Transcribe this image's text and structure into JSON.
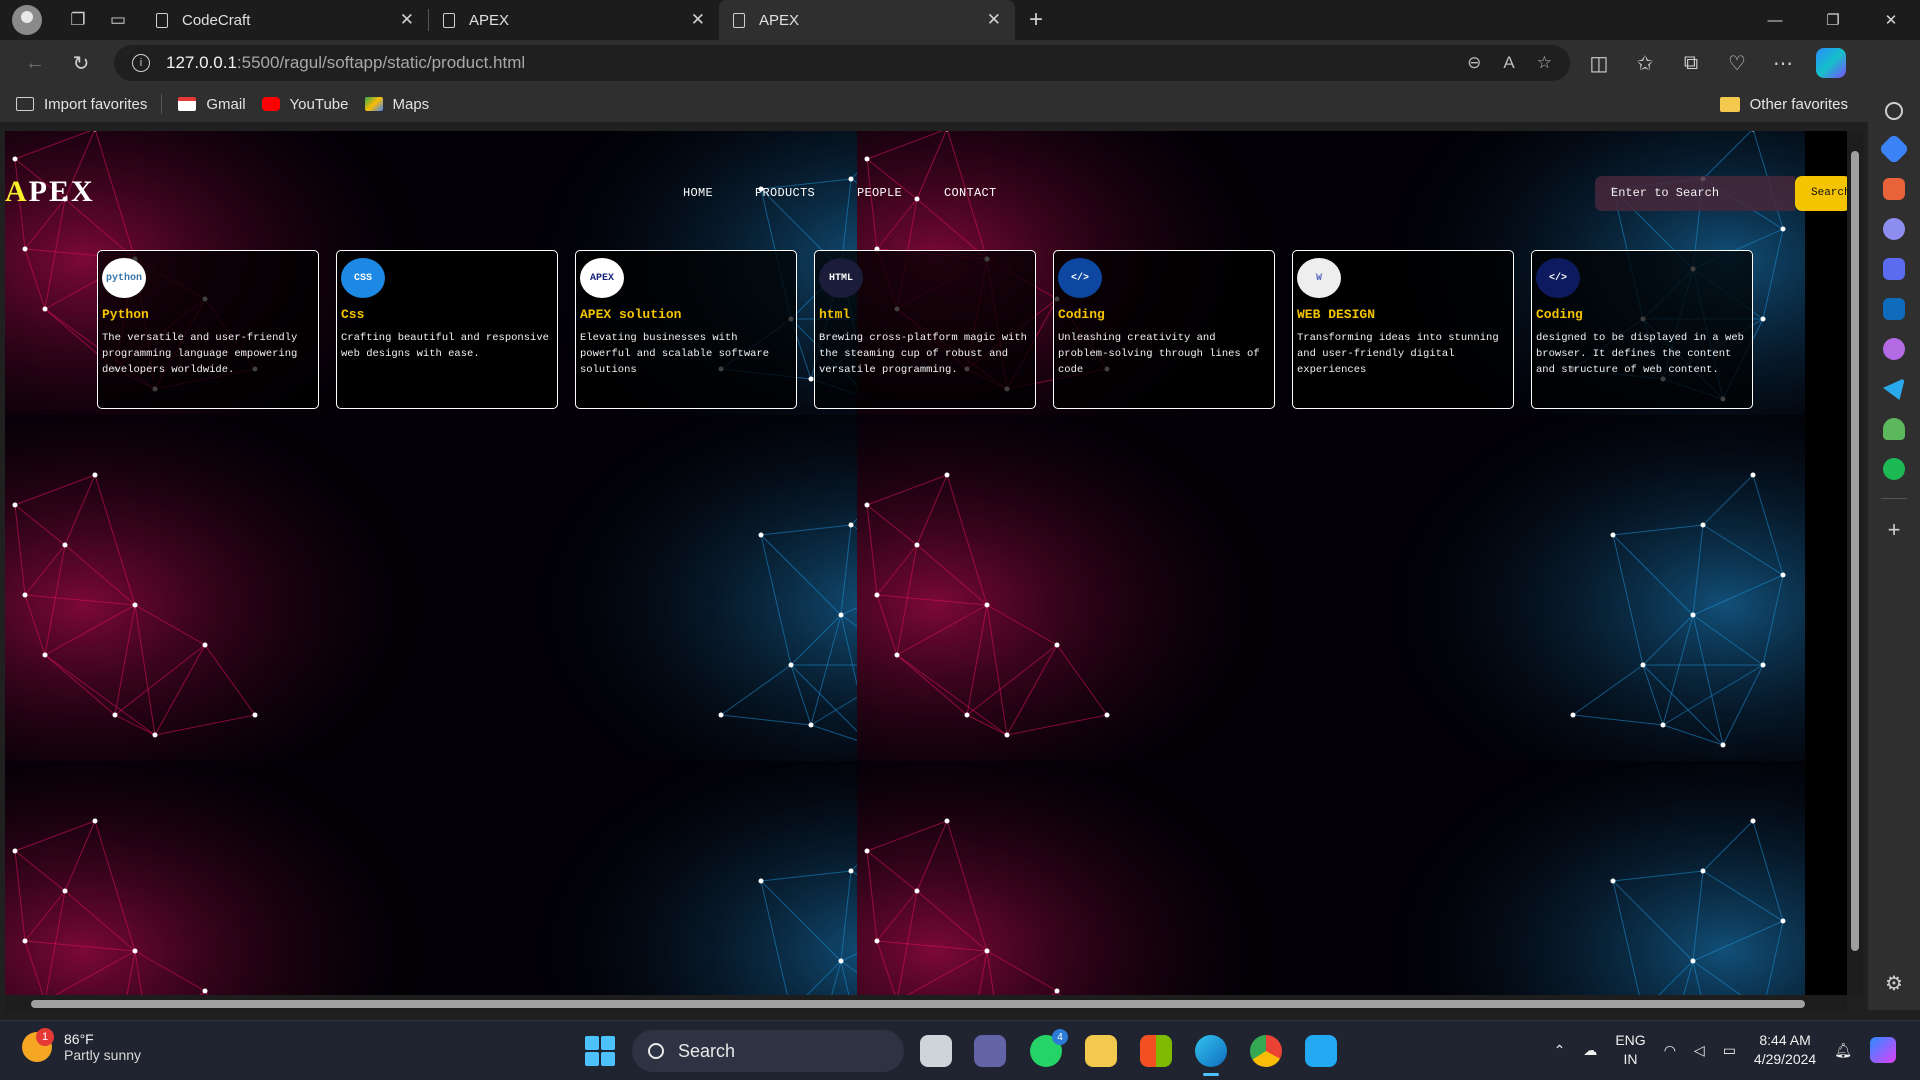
{
  "browser": {
    "tabs": [
      {
        "title": "CodeCraft",
        "active": false
      },
      {
        "title": "APEX",
        "active": false
      },
      {
        "title": "APEX",
        "active": true
      }
    ],
    "address": {
      "host": "127.0.0.1",
      "path": ":5500/ragul/softapp/static/product.html"
    },
    "favorites": [
      "Import favorites",
      "Gmail",
      "YouTube",
      "Maps"
    ],
    "other_favorites": "Other favorites"
  },
  "site": {
    "logo_first": "A",
    "logo_rest": "PEX",
    "menu": [
      "HOME",
      "PRODUCTS",
      "PEOPLE",
      "CONTACT"
    ],
    "search_placeholder": "Enter to Search",
    "search_button": "Search",
    "cards": [
      {
        "title": "Python",
        "desc": "The versatile and user-friendly programming language empowering developers worldwide.",
        "logo": "python",
        "logo_bg": "#ffffff",
        "logo_fg": "#3776ab"
      },
      {
        "title": "Css",
        "desc": "Crafting beautiful and responsive web designs with ease.",
        "logo": "CSS",
        "logo_bg": "#1e88e5",
        "logo_fg": "#ffffff"
      },
      {
        "title": "APEX solution",
        "desc": "Elevating businesses with powerful and scalable software solutions",
        "logo": "APEX",
        "logo_bg": "#ffffff",
        "logo_fg": "#1a237e"
      },
      {
        "title": "html",
        "desc": "Brewing cross-platform magic with the steaming cup of robust and versatile programming.",
        "logo": "HTML",
        "logo_bg": "#1b1b3a",
        "logo_fg": "#ffffff"
      },
      {
        "title": "Coding",
        "desc": "Unleashing creativity and problem-solving through lines of code",
        "logo": "</>",
        "logo_bg": "#0d47a1",
        "logo_fg": "#ffffff"
      },
      {
        "title": "WEB DESIGN",
        "desc": "Transforming ideas into stunning and user-friendly digital experiences",
        "logo": "W",
        "logo_bg": "#eeeeee",
        "logo_fg": "#5c6bc0"
      },
      {
        "title": "Coding",
        "desc": "designed to be displayed in a web browser. It defines the content and structure of web content.",
        "logo": "</>",
        "logo_bg": "#0d1b5e",
        "logo_fg": "#ffffff"
      }
    ]
  },
  "taskbar": {
    "weather_temp": "86°F",
    "weather_desc": "Partly sunny",
    "weather_badge": "1",
    "search": "Search",
    "whatsapp_badge": "4",
    "lang_1": "ENG",
    "lang_2": "IN",
    "time": "8:44 AM",
    "date": "4/29/2024"
  },
  "colors": {
    "accent_yellow": "#f5c400",
    "pink_glow": "#e0105e",
    "blue_glow": "#1e90d6"
  }
}
